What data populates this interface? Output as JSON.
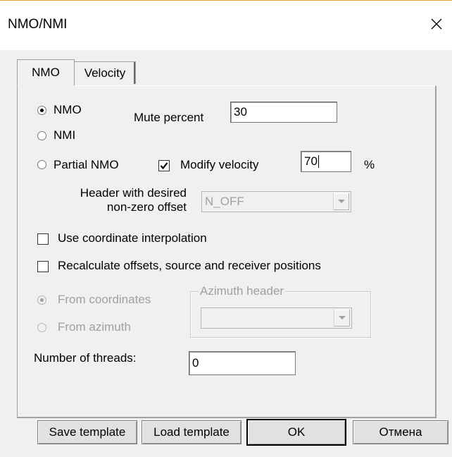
{
  "window": {
    "title": "NMO/NMI"
  },
  "tabs": [
    {
      "label": "NMO",
      "active": true
    },
    {
      "label": "Velocity",
      "active": false
    }
  ],
  "mode": {
    "options": [
      {
        "label": "NMO",
        "selected": true
      },
      {
        "label": "NMI",
        "selected": false
      },
      {
        "label": "Partial NMO",
        "selected": false
      }
    ]
  },
  "mute_percent": {
    "label": "Mute percent",
    "value": "30"
  },
  "modify_velocity": {
    "label": "Modify velocity",
    "checked": true,
    "value": "70",
    "unit": "%"
  },
  "header_offset": {
    "label_line1": "Header with desired",
    "label_line2": "non-zero offset",
    "value": "N_OFF"
  },
  "use_coord_interp": {
    "label": "Use coordinate interpolation",
    "checked": false
  },
  "recalc_offsets": {
    "label": "Recalculate offsets, source  and receiver positions",
    "checked": false
  },
  "recalc_source": {
    "options": [
      {
        "label": "From coordinates",
        "selected": true
      },
      {
        "label": "From azimuth",
        "selected": false
      }
    ]
  },
  "azimuth_header": {
    "title": "Azimuth header",
    "value": ""
  },
  "threads": {
    "label": "Number of threads:",
    "value": "0"
  },
  "buttons": {
    "save_template": "Save template",
    "load_template": "Load template",
    "ok": "OK",
    "cancel": "Отмена"
  },
  "colors": {
    "window_accent": "#e8a33a",
    "dialog_bg": "#f0f0f0",
    "disabled_text": "#a0a0a0"
  }
}
